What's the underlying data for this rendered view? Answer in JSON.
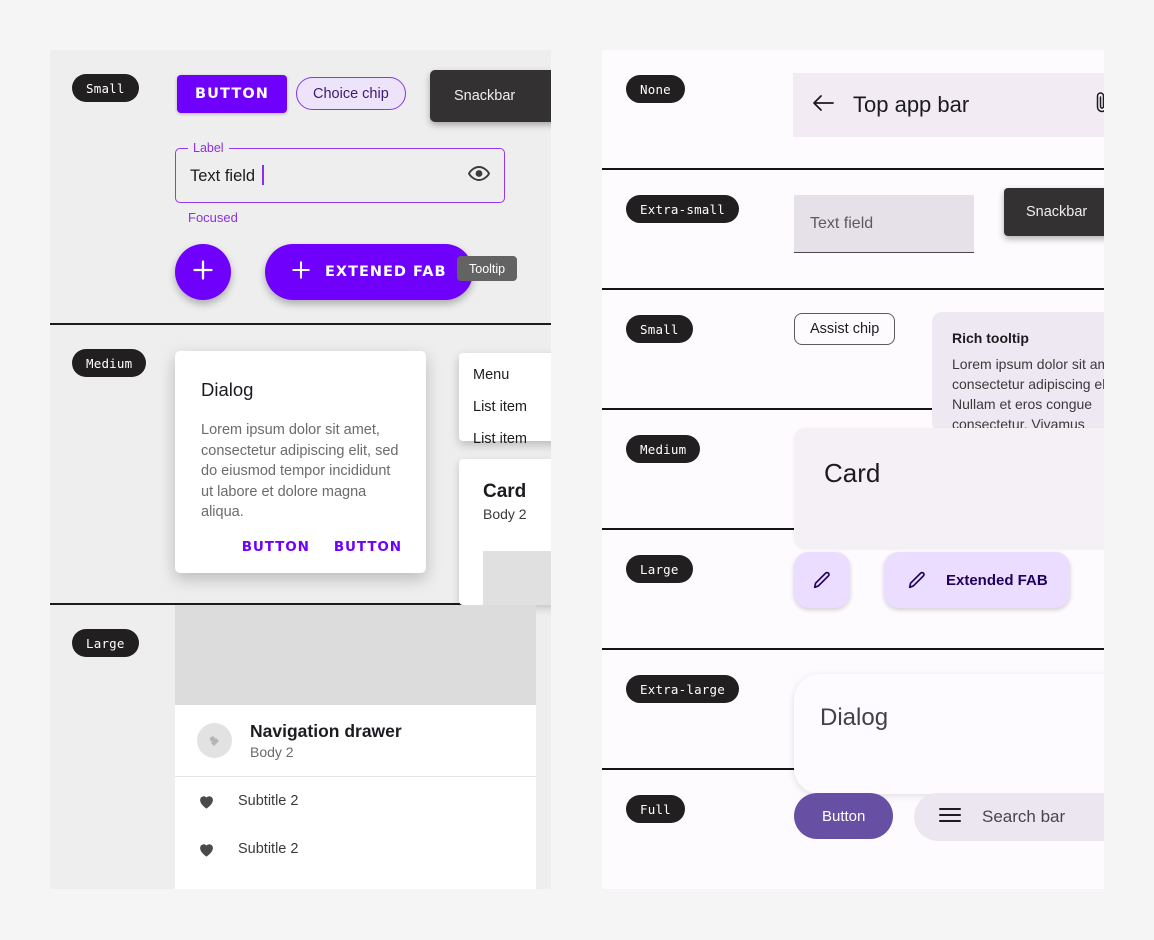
{
  "theme": {
    "page_bg": "#F5F5F5",
    "left_panel_bg": "#EEEEEE",
    "right_panel_bg": "#FEFBFF",
    "m2_primary": "#6E00FB",
    "m3_primary": "#6750A4",
    "m3_primary_container": "#EADDFF",
    "m3_on_primary_container": "#21005D",
    "scrim_dark": "#333132",
    "badge_bg": "#211F20"
  },
  "left_panel": {
    "sections": [
      {
        "badge": "Small",
        "button": {
          "label": "BUTTON"
        },
        "choice_chip": {
          "label": "Choice chip"
        },
        "snackbar": {
          "label": "Snackbar"
        },
        "text_field": {
          "label": "Label",
          "value": "Text field",
          "helper": "Focused",
          "trailing_icon": "eye-icon"
        },
        "fab": {
          "icon": "plus-icon"
        },
        "extended_fab": {
          "icon": "plus-icon",
          "label": "EXTENED FAB"
        },
        "tooltip": {
          "label": "Tooltip"
        }
      },
      {
        "badge": "Medium",
        "dialog": {
          "title": "Dialog",
          "body": "Lorem ipsum dolor sit amet, consectetur adipiscing elit, sed do eiusmod tempor incididunt ut labore et dolore magna aliqua.",
          "action_left": "BUTTON",
          "action_right": "BUTTON"
        },
        "menu": {
          "header": "Menu",
          "items": [
            "List item",
            "List item"
          ]
        },
        "card": {
          "title": "Card",
          "body": "Body 2"
        }
      },
      {
        "badge": "Large",
        "nav_drawer": {
          "title": "Navigation drawer",
          "subtitle": "Body 2",
          "items": [
            {
              "icon": "heart-icon",
              "label": "Subtitle 2"
            },
            {
              "icon": "heart-icon",
              "label": "Subtitle 2"
            }
          ]
        }
      }
    ]
  },
  "right_panel": {
    "rows": [
      {
        "badge": "None",
        "top_app_bar": {
          "back_icon": "arrow-left-icon",
          "title": "Top app bar",
          "trailing_icon": "attachment-icon"
        }
      },
      {
        "badge": "Extra-small",
        "text_field": {
          "placeholder": "Text field"
        },
        "snackbar": {
          "label": "Snackbar"
        }
      },
      {
        "badge": "Small",
        "assist_chip": {
          "label": "Assist chip"
        },
        "rich_tooltip": {
          "title": "Rich tooltip",
          "body": "Lorem ipsum dolor sit amet, consectetur adipiscing elit. Nullam et eros congue consectetur. Vivamus"
        }
      },
      {
        "badge": "Medium",
        "card": {
          "title": "Card"
        }
      },
      {
        "badge": "Large",
        "fab": {
          "icon": "pencil-icon"
        },
        "extended_fab": {
          "icon": "pencil-icon",
          "label": "Extended FAB"
        }
      },
      {
        "badge": "Extra-large",
        "dialog": {
          "title": "Dialog"
        }
      },
      {
        "badge": "Full",
        "button": {
          "label": "Button"
        },
        "search_bar": {
          "leading_icon": "menu-icon",
          "placeholder": "Search bar"
        }
      }
    ]
  }
}
